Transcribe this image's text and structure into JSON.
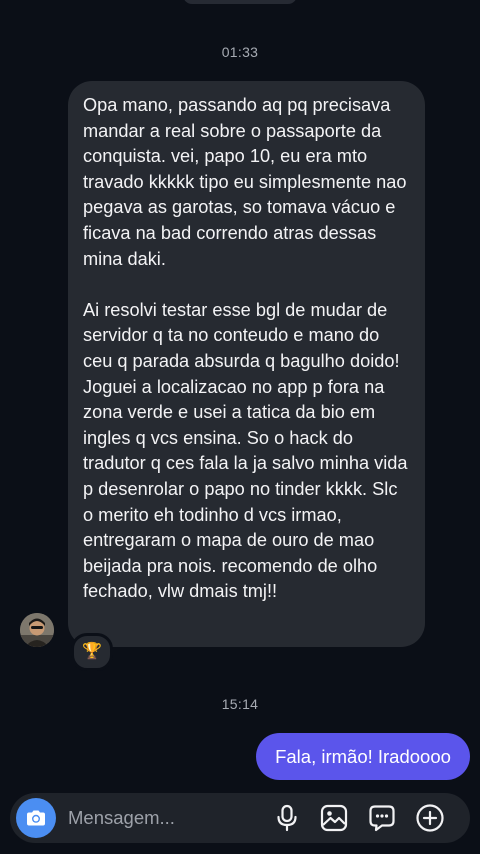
{
  "conversation": {
    "timestamp_first": "01:33",
    "timestamp_second": "15:14",
    "incoming_message": {
      "paragraph_1": "Opa mano, passando aq pq precisava mandar a real sobre o passaporte da conquista. vei, papo 10, eu era mto travado kkkkk tipo eu simplesmente nao pegava as garotas, so tomava vácuo e ficava na bad correndo atras dessas mina daki.",
      "paragraph_2": "Ai resolvi testar esse bgl de mudar de servidor q ta no conteudo e mano do ceu q parada absurda q bagulho doido! Joguei a localizacao no app p fora na zona verde e usei a tatica da bio em ingles q vcs ensina. So o hack do tradutor q ces fala la ja salvo minha vida p desenrolar o papo no tinder kkkk. Slc o merito eh todinho d vcs irmao, entregaram o mapa de ouro de mao beijada pra nois. recomendo de olho fechado, vlw dmais tmj!!",
      "reaction": "🏆"
    },
    "outgoing_message": "Fala, irmão! Iradoooo"
  },
  "composer": {
    "placeholder": "Mensagem...",
    "icons": [
      "camera-icon",
      "microphone-icon",
      "gallery-icon",
      "sticker-icon",
      "plus-icon"
    ]
  },
  "colors": {
    "background": "#0b0f17",
    "incoming_bubble": "#262a31",
    "outgoing_bubble": "#5b55eb",
    "camera_button": "#4b8ef2"
  }
}
